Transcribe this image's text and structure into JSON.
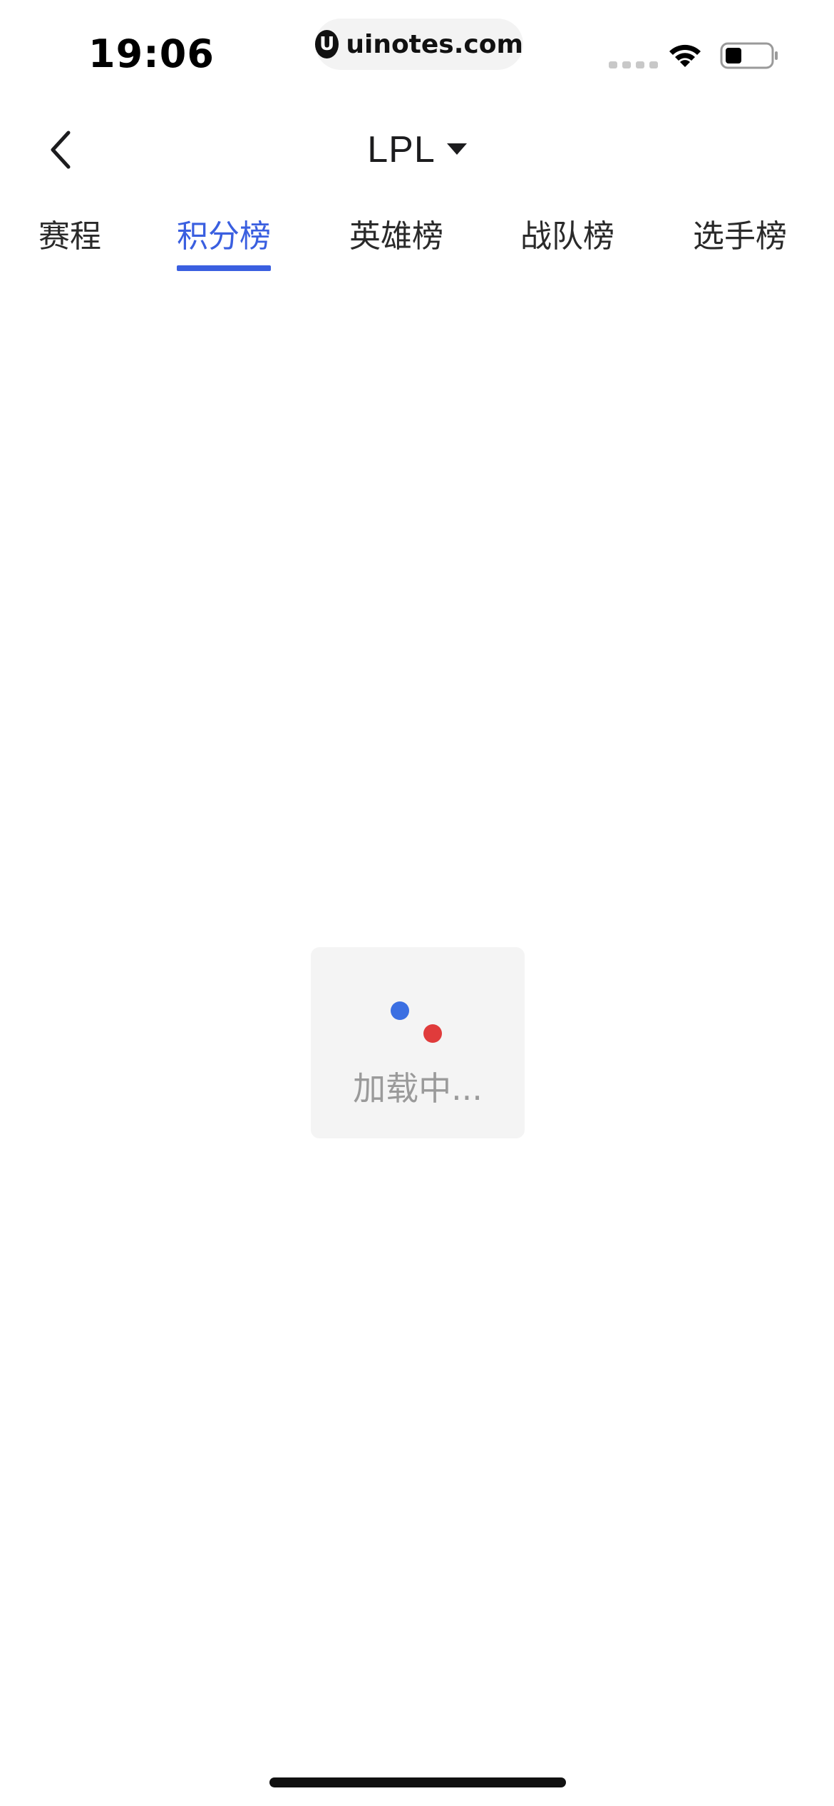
{
  "status_bar": {
    "time": "19:06",
    "url": "uinotes.com",
    "url_logo_glyph": "U"
  },
  "header": {
    "back_icon": "chevron-left-icon",
    "league": "LPL",
    "league_caret_icon": "caret-down-icon"
  },
  "tabs": [
    {
      "label": "赛程",
      "active": false
    },
    {
      "label": "积分榜",
      "active": true
    },
    {
      "label": "英雄榜",
      "active": false
    },
    {
      "label": "战队榜",
      "active": false
    },
    {
      "label": "选手榜",
      "active": false
    }
  ],
  "loading": {
    "text": "加载中...",
    "dot_colors": [
      "#3b6fe2",
      "#e03b3b"
    ]
  },
  "colors": {
    "accent": "#3a5fe0",
    "text": "#1c1c1e",
    "muted": "#9a9a9a",
    "loading_bg": "#f4f4f4"
  }
}
